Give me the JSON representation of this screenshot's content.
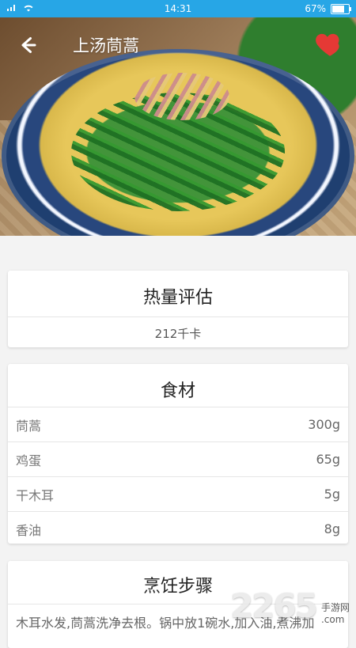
{
  "status_bar": {
    "time": "14:31",
    "battery_percent": "67%",
    "battery_level": 0.67,
    "bg_color": "#27a6e6"
  },
  "header": {
    "title": "上汤茼蒿",
    "back_icon": "arrow-left-icon",
    "favorite_icon": "heart-icon",
    "favorite_color": "#e53935"
  },
  "calories": {
    "title": "热量评估",
    "value": "212千卡"
  },
  "ingredients": {
    "title": "食材",
    "items": [
      {
        "name": "茼蒿",
        "qty": "300g"
      },
      {
        "name": "鸡蛋",
        "qty": "65g"
      },
      {
        "name": "干木耳",
        "qty": "5g"
      },
      {
        "name": "香油",
        "qty": "8g"
      }
    ]
  },
  "steps": {
    "title": "烹饪步骤",
    "text": "木耳水发,茼蒿洗净去根。锅中放1碗水,加入油,煮沸加"
  },
  "watermark": {
    "brand": "2265",
    "sub1": "手游网",
    "sub2": ".com"
  }
}
